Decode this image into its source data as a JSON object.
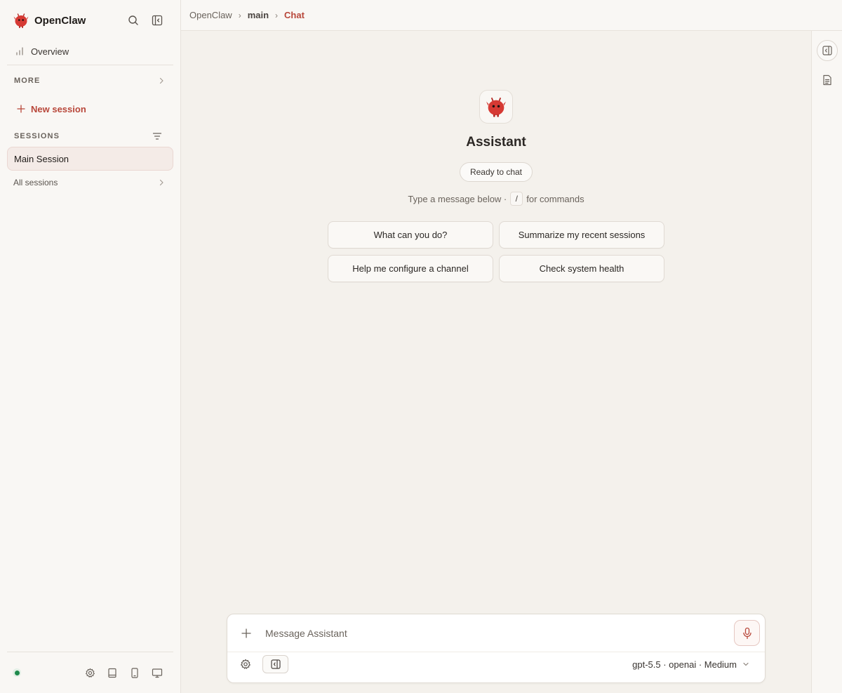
{
  "app": {
    "name": "OpenClaw"
  },
  "sidebar": {
    "overview_label": "Overview",
    "more_label": "MORE",
    "new_session_label": "New session",
    "sessions_label": "SESSIONS",
    "sessions": [
      {
        "label": "Main Session",
        "active": true
      }
    ],
    "all_sessions_label": "All sessions",
    "footer_icons": [
      "settings-icon",
      "book-icon",
      "phone-icon",
      "monitor-icon"
    ],
    "connection_status_color": "#1f8a4c"
  },
  "breadcrumb": {
    "root": "OpenClaw",
    "middle": "main",
    "current": "Chat"
  },
  "chat": {
    "assistant_name": "Assistant",
    "status_badge": "Ready to chat",
    "hint_prefix": "Type a message below ·",
    "hint_key": "/",
    "hint_suffix": "for commands",
    "suggestions": [
      "What can you do?",
      "Summarize my recent sessions",
      "Help me configure a channel",
      "Check system health"
    ]
  },
  "composer": {
    "placeholder": "Message Assistant",
    "model_label": "gpt-5.5 · openai · Medium"
  },
  "colors": {
    "accent": "#b8473a",
    "background": "#f4f1ec",
    "sidebar": "#f9f7f4"
  }
}
